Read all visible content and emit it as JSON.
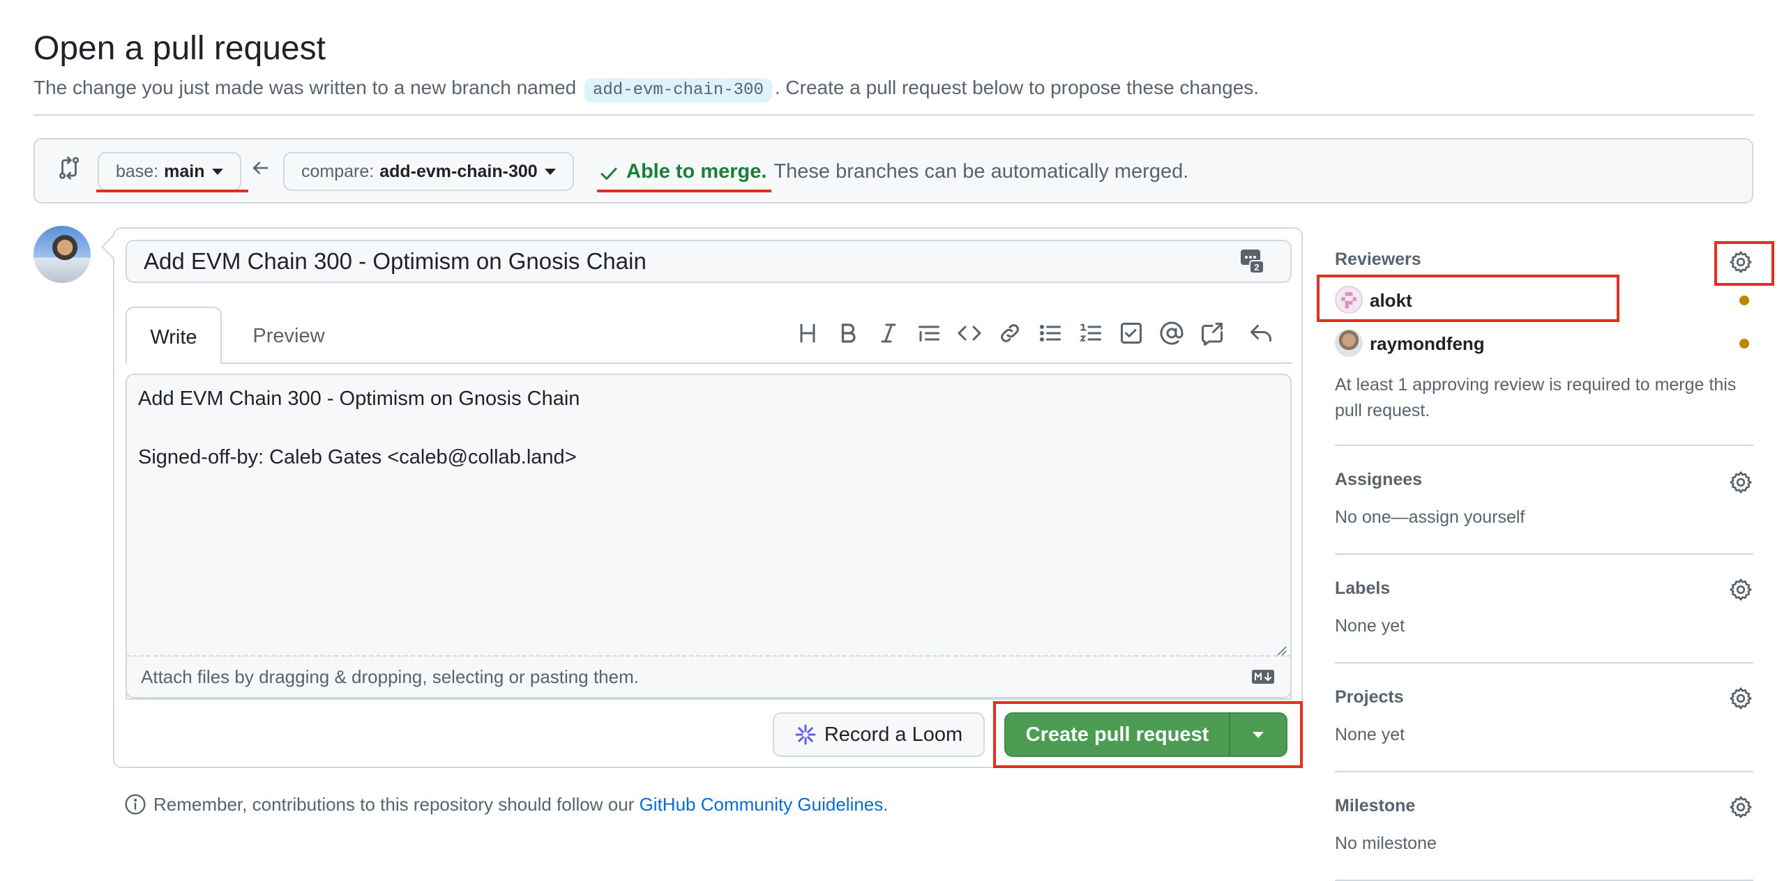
{
  "header": {
    "title": "Open a pull request",
    "subtitle_pre": "The change you just made was written to a new branch named",
    "branch_name": "add-evm-chain-300",
    "subtitle_post": ". Create a pull request below to propose these changes."
  },
  "range": {
    "base_label": "base:",
    "base_value": "main",
    "compare_label": "compare:",
    "compare_value": "add-evm-chain-300",
    "merge_status": "Able to merge.",
    "merge_text": "These branches can be automatically merged."
  },
  "form": {
    "title_value": "Add EVM Chain 300 - Optimism on Gnosis Chain",
    "saved_replies_count": "2",
    "tabs": {
      "write": "Write",
      "preview": "Preview"
    },
    "toolbar_icons": [
      "heading-icon",
      "bold-icon",
      "italic-icon",
      "quote-icon",
      "code-icon",
      "link-icon",
      "unordered-list-icon",
      "ordered-list-icon",
      "task-list-icon",
      "mention-icon",
      "cross-reference-icon",
      "undo-icon"
    ],
    "body_lines": [
      "Add EVM Chain 300 - Optimism on Gnosis Chain",
      "",
      "Signed-off-by: Caleb Gates <caleb@collab.land>"
    ],
    "attach_text": "Attach files by dragging & dropping, selecting or pasting them.",
    "loom_label": "Record a Loom",
    "create_label": "Create pull request"
  },
  "footer": {
    "note_pre": "Remember, contributions to this repository should follow our",
    "note_link": "GitHub Community Guidelines",
    "note_post": "."
  },
  "sidebar": {
    "reviewers": {
      "heading": "Reviewers",
      "people": [
        {
          "name": "alokt"
        },
        {
          "name": "raymondfeng"
        }
      ],
      "note": "At least 1 approving review is required to merge this pull request."
    },
    "assignees": {
      "heading": "Assignees",
      "value": "No one—assign yourself"
    },
    "labels": {
      "heading": "Labels",
      "value": "None yet"
    },
    "projects": {
      "heading": "Projects",
      "value": "None yet"
    },
    "milestone": {
      "heading": "Milestone",
      "value": "No milestone"
    }
  },
  "colors": {
    "accent_green": "#4c9c54",
    "success_text": "#1a7f37",
    "link": "#0969da",
    "pending": "#bf8700",
    "highlight_annotation": "#e0301e"
  }
}
